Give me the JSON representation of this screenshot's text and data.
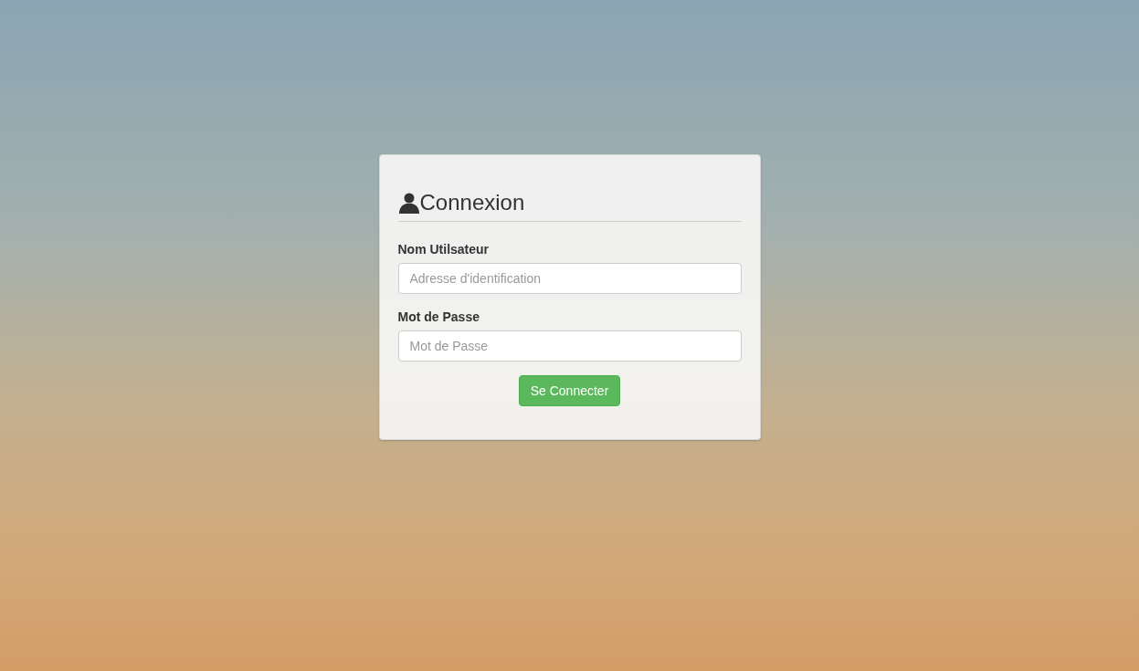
{
  "login_card": {
    "title": "Connexion",
    "fields": [
      {
        "label": "Nom Utilsateur",
        "placeholder": "Adresse d'identification"
      },
      {
        "label": "Mot de Passe",
        "placeholder": "Mot de Passe"
      }
    ],
    "submit_button": "Se Connecter"
  }
}
